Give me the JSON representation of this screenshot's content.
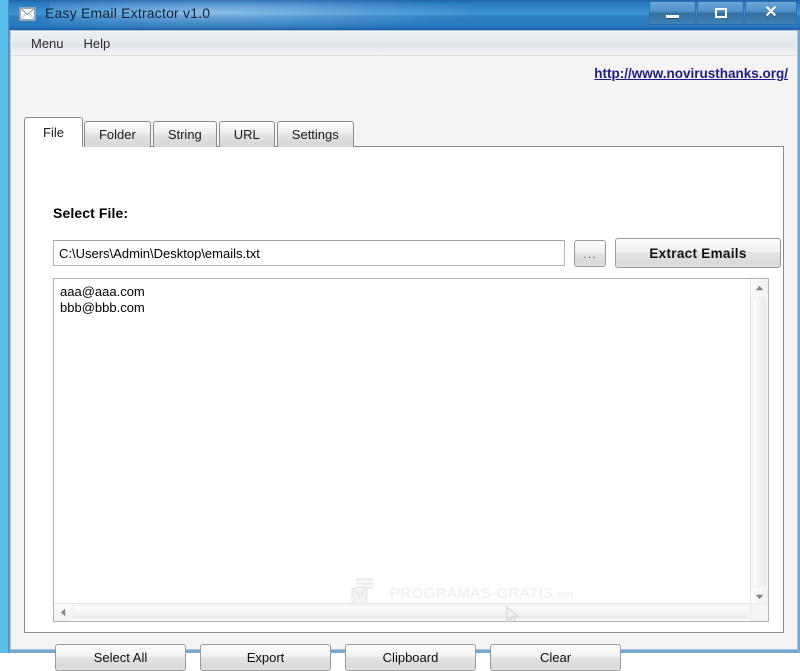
{
  "window": {
    "title": "Easy Email Extractor v1.0",
    "icon": "envelope-icon",
    "controls": {
      "minimize": "Minimize",
      "maximize": "Maximize",
      "close": "Close"
    }
  },
  "menubar": {
    "items": [
      {
        "label": "Menu"
      },
      {
        "label": "Help"
      }
    ]
  },
  "weblink": {
    "label": "http://www.novirusthanks.org/",
    "color": "#1d1d8c"
  },
  "tabs": [
    {
      "label": "File",
      "active": true
    },
    {
      "label": "Folder",
      "active": false
    },
    {
      "label": "String",
      "active": false
    },
    {
      "label": "URL",
      "active": false
    },
    {
      "label": "Settings",
      "active": false
    }
  ],
  "file_tab": {
    "select_file_label": "Select File:",
    "path_value": "C:\\Users\\Admin\\Desktop\\emails.txt",
    "path_placeholder": "",
    "browse_label": "...",
    "extract_label": "Extract Emails",
    "results": [
      "aaa@aaa.com",
      "bbb@bbb.com"
    ]
  },
  "watermark": {
    "text_main": "PROGRAMAS-GRATIS",
    "text_suffix": ".net"
  },
  "bottom_buttons": [
    {
      "label": "Select All"
    },
    {
      "label": "Export"
    },
    {
      "label": "Clipboard"
    },
    {
      "label": "Clear"
    }
  ]
}
